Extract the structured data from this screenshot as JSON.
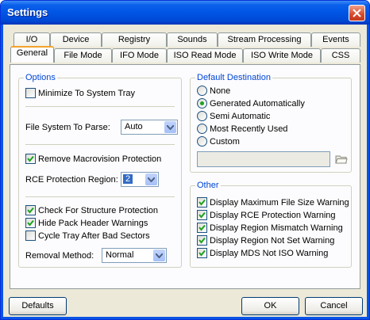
{
  "window": {
    "title": "Settings"
  },
  "tabs": {
    "back_row": [
      "I/O",
      "Device",
      "Registry",
      "Sounds",
      "Stream Processing",
      "Events"
    ],
    "front_row": [
      "General",
      "File Mode",
      "IFO Mode",
      "ISO Read Mode",
      "ISO Write Mode",
      "CSS"
    ],
    "active": "General"
  },
  "options": {
    "title": "Options",
    "minimize_to_tray": {
      "label": "Minimize To System Tray",
      "checked": false
    },
    "fs_parse": {
      "label": "File System To Parse:",
      "value": "Auto"
    },
    "remove_macrovision": {
      "label": "Remove Macrovision Protection",
      "checked": true
    },
    "rce_region": {
      "label": "RCE Protection Region:",
      "value": "2"
    },
    "check_structure": {
      "label": "Check For Structure Protection",
      "checked": true
    },
    "hide_pack_header": {
      "label": "Hide Pack Header Warnings",
      "checked": true
    },
    "cycle_tray": {
      "label": "Cycle Tray After Bad Sectors",
      "checked": false
    },
    "removal_method": {
      "label": "Removal Method:",
      "value": "Normal"
    }
  },
  "destination": {
    "title": "Default Destination",
    "options": [
      "None",
      "Generated Automatically",
      "Semi Automatic",
      "Most Recently Used",
      "Custom"
    ],
    "selected": "Generated Automatically",
    "path": ""
  },
  "other": {
    "title": "Other",
    "items": [
      {
        "label": "Display Maximum File Size Warning",
        "checked": true
      },
      {
        "label": "Display RCE Protection Warning",
        "checked": true
      },
      {
        "label": "Display Region Mismatch Warning",
        "checked": true
      },
      {
        "label": "Display Region Not Set Warning",
        "checked": true
      },
      {
        "label": "Display MDS Not ISO Warning",
        "checked": true
      }
    ]
  },
  "buttons": {
    "defaults": "Defaults",
    "ok": "OK",
    "cancel": "Cancel"
  },
  "colors": {
    "titlebar": "#0055e5",
    "group_title": "#0046d5",
    "dialog_bg": "#ece9d8",
    "check": "#21a121"
  }
}
